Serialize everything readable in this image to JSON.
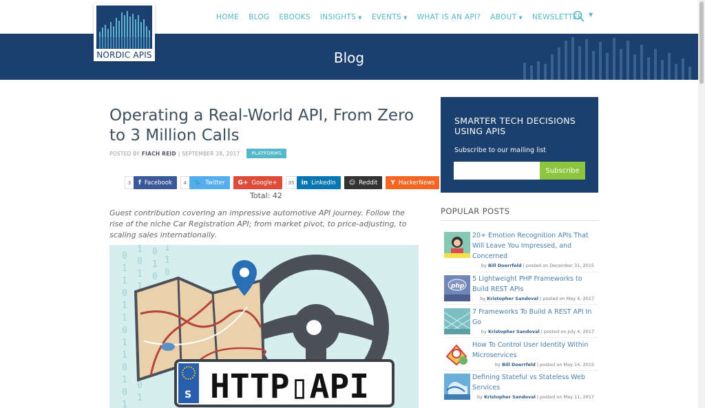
{
  "brand": {
    "name": "NORDIC APIS"
  },
  "nav": {
    "items": [
      {
        "label": "HOME",
        "dropdown": false
      },
      {
        "label": "BLOG",
        "dropdown": false
      },
      {
        "label": "EBOOKS",
        "dropdown": false
      },
      {
        "label": "INSIGHTS",
        "dropdown": true
      },
      {
        "label": "EVENTS",
        "dropdown": true
      },
      {
        "label": "WHAT IS AN API?",
        "dropdown": false
      },
      {
        "label": "ABOUT",
        "dropdown": true
      },
      {
        "label": "NEWSLETTER",
        "dropdown": false
      }
    ],
    "search_icon": "search-icon",
    "accent_color": "#55b8c9"
  },
  "banner": {
    "title": "Blog",
    "color": "#1b4070"
  },
  "article": {
    "title": "Operating a Real-World API, From Zero to 3 Million Calls",
    "posted_by_label": "POSTED BY",
    "author": "FIACH REID",
    "date": "| SEPTEMBER 28, 2017",
    "tag": "PLATFORMS",
    "intro": "Guest contribution covering an impressive automotive API journey. Follow the rise of the niche Car Registration API; from market pivot, to price-adjusting, to scaling sales internationally.",
    "hero_text": "HTTP▯API",
    "plate_letter": "S"
  },
  "share": {
    "buttons": [
      {
        "label": "Facebook",
        "count": "3",
        "icon": "f",
        "color": "#3b5998"
      },
      {
        "label": "Twitter",
        "count": "4",
        "icon": "🐦",
        "color": "#55acee"
      },
      {
        "label": "Google+",
        "count": "",
        "icon": "G+",
        "color": "#dd4b39"
      },
      {
        "label": "LinkedIn",
        "count": "35",
        "icon": "in",
        "color": "#0976b4"
      },
      {
        "label": "Reddit",
        "count": "",
        "icon": "☺",
        "color": "#333333"
      },
      {
        "label": "HackerNews",
        "count": "",
        "icon": "Y",
        "color": "#f26522"
      }
    ],
    "total": "Total: 42"
  },
  "signup": {
    "title": "SMARTER TECH DECISIONS USING APIS",
    "subtitle": "Subscribe to our mailing list",
    "input_placeholder": "",
    "button_label": "Subscribe",
    "button_color": "#8cc63f"
  },
  "popular": {
    "heading": "POPULAR POSTS",
    "posts": [
      {
        "title": "20+ Emotion Recognition APIs That Will Leave You Impressed, and Concerned",
        "by": "by",
        "author": "Bill Doerrfeld",
        "date": "| posted on December 31, 2015",
        "thumb": "emotion-thumb"
      },
      {
        "title": "5 Lightweight PHP Frameworks to Build REST APIs",
        "by": "by",
        "author": "Kristopher Sandoval",
        "date": "| posted on May 4, 2017",
        "thumb": "php-thumb"
      },
      {
        "title": "7 Frameworks To Build A REST API In Go",
        "by": "by",
        "author": "Kristopher Sandoval",
        "date": "| posted on July 4, 2017",
        "thumb": "go-thumb"
      },
      {
        "title": "How To Control User Identity Within Microservices",
        "by": "by",
        "author": "Bill Doerrfeld",
        "date": "| posted on May 14, 2015",
        "thumb": "identity-thumb"
      },
      {
        "title": "Defining Stateful vs Stateless Web Services",
        "by": "by",
        "author": "Kristopher Sandoval",
        "date": "| posted on May 11, 2017",
        "thumb": "stateful-thumb"
      }
    ]
  }
}
